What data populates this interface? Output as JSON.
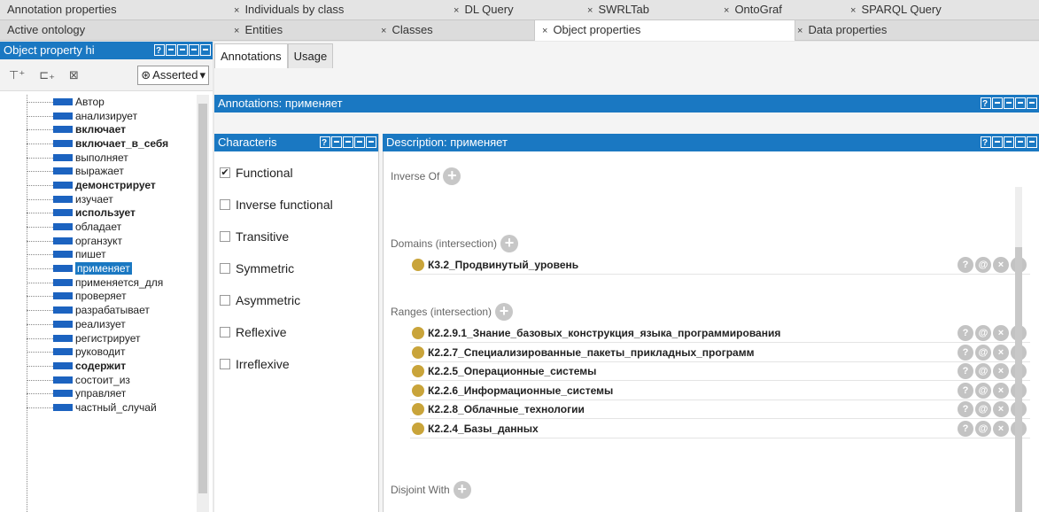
{
  "top_tabs": [
    {
      "label": "Annotation properties",
      "closable": false
    },
    {
      "label": "Individuals by class",
      "closable": true
    },
    {
      "label": "DL Query",
      "closable": true
    },
    {
      "label": "SWRLTab",
      "closable": true
    },
    {
      "label": "OntoGraf",
      "closable": true
    },
    {
      "label": "SPARQL Query",
      "closable": true
    }
  ],
  "second_tabs": [
    {
      "label": "Active ontology",
      "closable": false
    },
    {
      "label": "Entities",
      "closable": true
    },
    {
      "label": "Classes",
      "closable": true
    },
    {
      "label": "Object properties",
      "closable": true,
      "active": true
    },
    {
      "label": "Data properties",
      "closable": true
    }
  ],
  "close_glyph": "×",
  "left_panel": {
    "title": "Object property hi",
    "mode": "Asserted",
    "items": [
      {
        "label": "Автор",
        "bold": false
      },
      {
        "label": "анализирует",
        "bold": false
      },
      {
        "label": "включает",
        "bold": true
      },
      {
        "label": "включает_в_себя",
        "bold": true
      },
      {
        "label": "выполняет",
        "bold": false
      },
      {
        "label": "выражает",
        "bold": false
      },
      {
        "label": "демонстрирует",
        "bold": true
      },
      {
        "label": "изучает",
        "bold": false
      },
      {
        "label": "использует",
        "bold": true
      },
      {
        "label": "обладает",
        "bold": false
      },
      {
        "label": "органзукт",
        "bold": false
      },
      {
        "label": "пишет",
        "bold": false
      },
      {
        "label": "применяет",
        "bold": false,
        "selected": true
      },
      {
        "label": "применяется_для",
        "bold": false
      },
      {
        "label": "проверяет",
        "bold": false
      },
      {
        "label": "разрабатывает",
        "bold": false
      },
      {
        "label": "реализует",
        "bold": false
      },
      {
        "label": "регистрирует",
        "bold": false
      },
      {
        "label": "руководит",
        "bold": false
      },
      {
        "label": "содержит",
        "bold": true
      },
      {
        "label": "состоит_из",
        "bold": false
      },
      {
        "label": "управляет",
        "bold": false
      },
      {
        "label": "частный_случай",
        "bold": false
      }
    ]
  },
  "sub_tabs": [
    "Annotations",
    "Usage"
  ],
  "annotations_title": "Annotations: применяет",
  "characteristics": {
    "title": "Characteris",
    "items": [
      {
        "label": "Functional",
        "checked": true
      },
      {
        "label": "Inverse functional",
        "checked": false
      },
      {
        "label": "Transitive",
        "checked": false
      },
      {
        "label": "Symmetric",
        "checked": false
      },
      {
        "label": "Asymmetric",
        "checked": false
      },
      {
        "label": "Reflexive",
        "checked": false
      },
      {
        "label": "Irreflexive",
        "checked": false
      }
    ]
  },
  "description": {
    "title": "Description: применяет",
    "inverse_of": "Inverse Of",
    "domains_label": "Domains (intersection)",
    "domains": [
      "К3.2_Продвинутый_уровень"
    ],
    "ranges_label": "Ranges (intersection)",
    "ranges": [
      "К2.2.9.1_Знание_базовых_конструкция_языка_программирования",
      "К2.2.7_Специализированные_пакеты_прикладных_программ",
      "К2.2.5_Операционные_системы",
      "К2.2.6_Информационные_системы",
      "К2.2.8_Облачные_технологии",
      "К2.2.4_Базы_данных"
    ],
    "disjoint_label": "Disjoint With"
  },
  "colors": {
    "accent": "#1a78c2",
    "property_bar": "#1c63c0",
    "class_dot": "#c9a43a"
  }
}
